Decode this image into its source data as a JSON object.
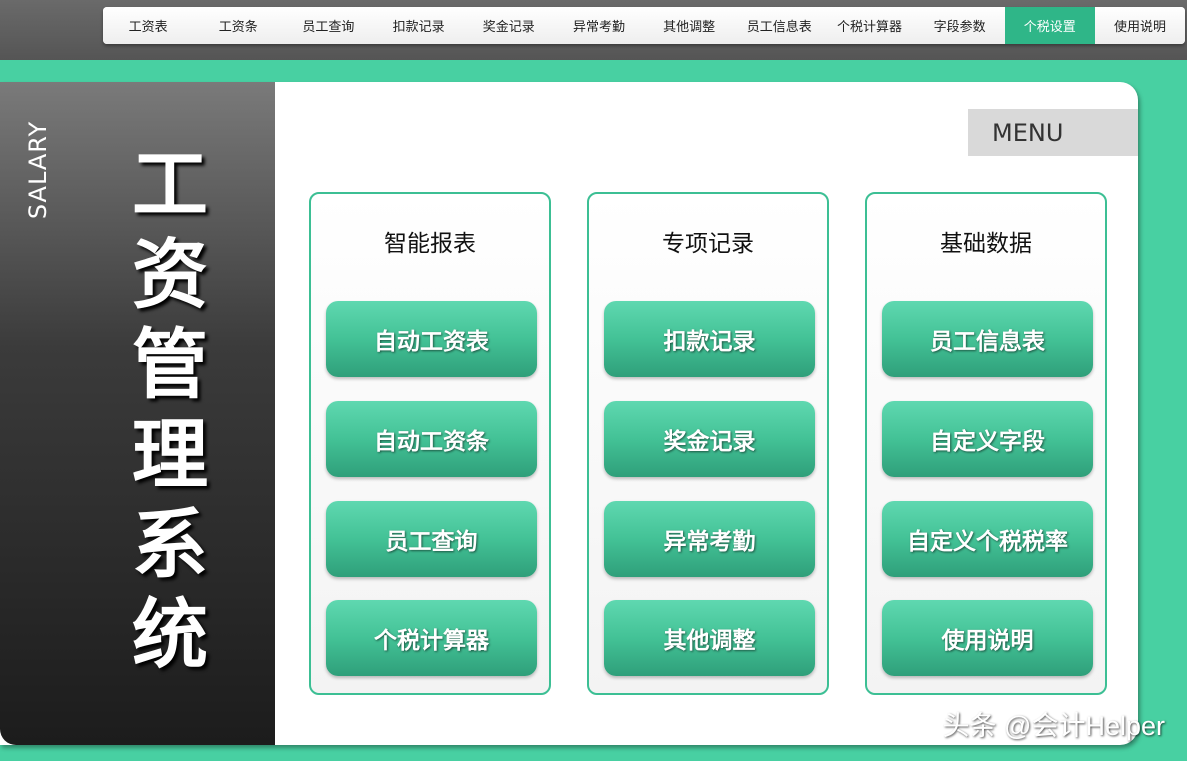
{
  "tabs": [
    {
      "label": "工资表"
    },
    {
      "label": "工资条"
    },
    {
      "label": "员工查询"
    },
    {
      "label": "扣款记录"
    },
    {
      "label": "奖金记录"
    },
    {
      "label": "异常考勤"
    },
    {
      "label": "其他调整"
    },
    {
      "label": "员工信息表"
    },
    {
      "label": "个税计算器"
    },
    {
      "label": "字段参数"
    },
    {
      "label": "个税设置"
    },
    {
      "label": "使用说明"
    }
  ],
  "active_tab": "个税设置",
  "side": {
    "subtitle": "SALARY",
    "title_chars": [
      "工",
      "资",
      "管",
      "理",
      "系",
      "统"
    ]
  },
  "menu_label": "MENU",
  "groups": [
    {
      "title": "智能报表",
      "buttons": [
        "自动工资表",
        "自动工资条",
        "员工查询",
        "个税计算器"
      ]
    },
    {
      "title": "专项记录",
      "buttons": [
        "扣款记录",
        "奖金记录",
        "异常考勤",
        "其他调整"
      ]
    },
    {
      "title": "基础数据",
      "buttons": [
        "员工信息表",
        "自定义字段",
        "自定义个税税率",
        "使用说明"
      ]
    }
  ],
  "watermark": "头条 @会计Helper",
  "colors": {
    "accent": "#48d0a2",
    "active_tab": "#2fb688",
    "button": "#43c296"
  }
}
